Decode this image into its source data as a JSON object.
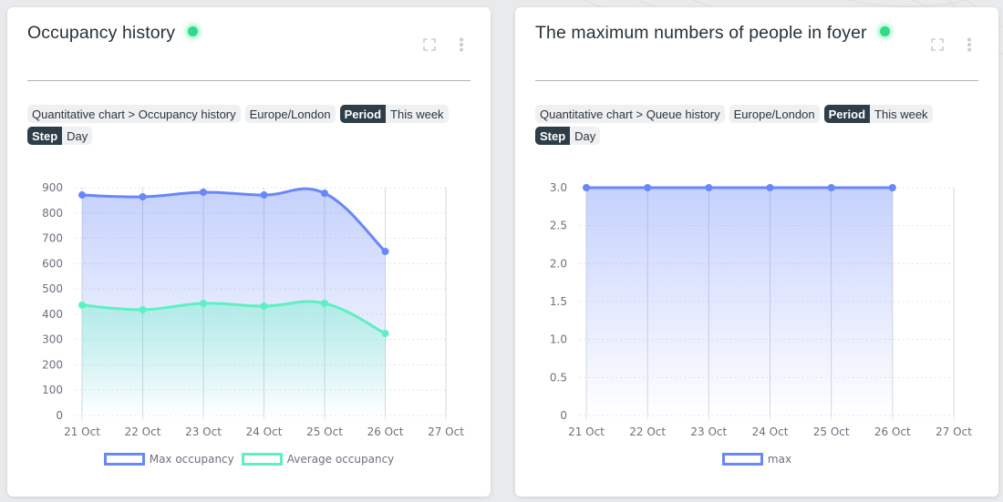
{
  "colors": {
    "max_series": "#6887f9",
    "avg_series": "#5ef0c2",
    "status_online": "#2fdc84",
    "tag_key_bg": "#2e3e48",
    "axis_text": "#6f6f80",
    "grid": "#e4e6ea"
  },
  "panels": [
    {
      "title": "Occupancy history",
      "status": "online",
      "icons": [
        "expand-icon",
        "more-vertical-icon"
      ],
      "tags": {
        "source": "Quantitative chart > Occupancy history",
        "timezone": "Europe/London",
        "period_key": "Period",
        "period_value": "This week",
        "step_key": "Step",
        "step_value": "Day"
      },
      "legend": [
        "Max occupancy",
        "Average occupancy"
      ]
    },
    {
      "title": "The maximum numbers of people in foyer",
      "status": "online",
      "icons": [
        "expand-icon",
        "more-vertical-icon"
      ],
      "tags": {
        "source": "Quantitative chart > Queue history",
        "timezone": "Europe/London",
        "period_key": "Period",
        "period_value": "This week",
        "step_key": "Step",
        "step_value": "Day"
      },
      "legend": [
        "max"
      ]
    }
  ],
  "chart_data": [
    {
      "type": "area",
      "title": "Occupancy history",
      "xlabel": "",
      "ylabel": "",
      "categories": [
        "21 Oct",
        "22 Oct",
        "23 Oct",
        "24 Oct",
        "25 Oct",
        "26 Oct",
        "27 Oct"
      ],
      "ylim": [
        0,
        900
      ],
      "yticks": [
        "0",
        "100",
        "200",
        "300",
        "400",
        "500",
        "600",
        "700",
        "800",
        "900"
      ],
      "grid": true,
      "legend_position": "bottom",
      "series": [
        {
          "name": "Max occupancy",
          "color": "#6887f9",
          "values": [
            871,
            864,
            882,
            871,
            878,
            648
          ]
        },
        {
          "name": "Average occupancy",
          "color": "#5ef0c2",
          "values": [
            436,
            418,
            443,
            432,
            443,
            324
          ]
        }
      ]
    },
    {
      "type": "area",
      "title": "The maximum numbers of people in foyer",
      "xlabel": "",
      "ylabel": "",
      "categories": [
        "21 Oct",
        "22 Oct",
        "23 Oct",
        "24 Oct",
        "25 Oct",
        "26 Oct",
        "27 Oct"
      ],
      "ylim": [
        0,
        3.0
      ],
      "yticks": [
        "0",
        "0.5",
        "1.0",
        "1.5",
        "2.0",
        "2.5",
        "3.0"
      ],
      "grid": true,
      "legend_position": "bottom",
      "series": [
        {
          "name": "max",
          "color": "#6887f9",
          "values": [
            3,
            3,
            3,
            3,
            3,
            3
          ]
        }
      ]
    }
  ]
}
